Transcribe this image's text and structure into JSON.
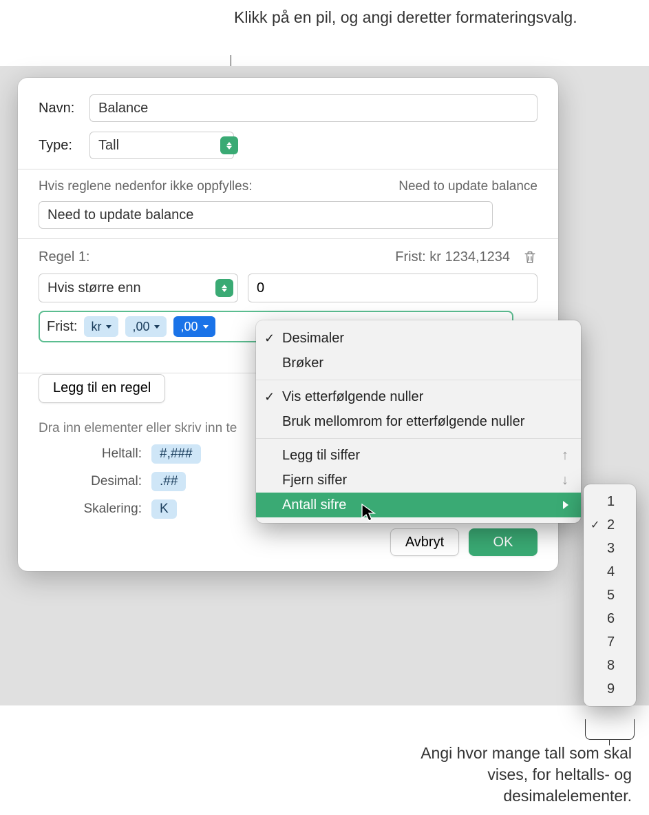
{
  "annotations": {
    "top": "Klikk på en pil, og angi deretter formateringsvalg.",
    "bottom": "Angi hvor mange tall som skal vises, for heltalls- og desimalelementer."
  },
  "form": {
    "name_label": "Navn:",
    "name_value": "Balance",
    "type_label": "Type:",
    "type_value": "Tall",
    "if_rules_label": "Hvis reglene nedenfor ikke oppfylles:",
    "if_rules_preview": "Need to update balance",
    "default_value": "Need to update balance"
  },
  "rule": {
    "title": "Regel 1:",
    "preview": "Frist: kr 1234,1234",
    "condition_select": "Hvis større enn",
    "condition_value": "0",
    "format_label": "Frist:",
    "tokens": {
      "currency": "kr",
      "dec1": ",00",
      "dec2": ",00"
    }
  },
  "add_rule_btn": "Legg til en regel",
  "drag_hint": "Dra inn elementer eller skriv inn te",
  "elements": {
    "integer_label": "Heltall:",
    "integer_token": "#,###",
    "decimal_label": "Desimal:",
    "decimal_token": ".##",
    "scale_label": "Skalering:",
    "scale_token": "K"
  },
  "dialog": {
    "cancel": "Avbryt",
    "ok": "OK"
  },
  "popup": {
    "decimals": "Desimaler",
    "fractions": "Brøker",
    "trailing_zeros": "Vis etterfølgende nuller",
    "space_trailing": "Bruk mellomrom for etterfølgende nuller",
    "add_digit": "Legg til siffer",
    "remove_digit": "Fjern siffer",
    "num_digits": "Antall sifre"
  },
  "submenu": {
    "selected": "2",
    "items": [
      "1",
      "2",
      "3",
      "4",
      "5",
      "6",
      "7",
      "8",
      "9"
    ]
  }
}
